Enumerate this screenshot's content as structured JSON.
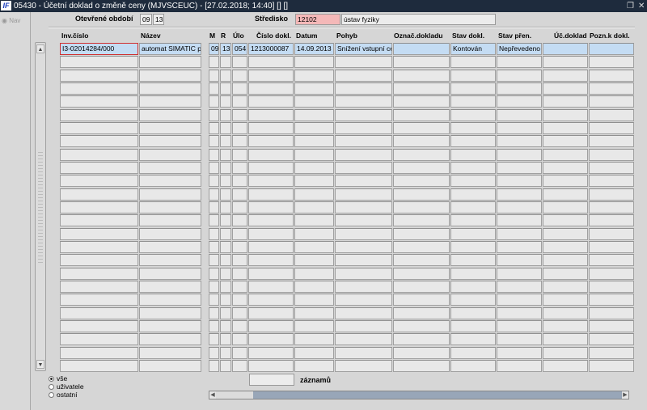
{
  "window": {
    "title": "05430 - Účetní doklad o změně ceny (MJVSCEUC) - [27.02.2018; 14:40]  [] []",
    "logo": "IF",
    "restore_icon": "restore-icon",
    "close_icon": "close-icon"
  },
  "nav": {
    "label": "Nav"
  },
  "header": {
    "period_label": "Otevřené období",
    "period_month": "09",
    "period_year": "13",
    "center_label": "Středisko",
    "center_code": "12102",
    "center_name": "ústav fyziky",
    "center_code_color": "#f4b8b8"
  },
  "table": {
    "columns": [
      "Inv.číslo",
      "Název",
      "M",
      "R",
      "Úlo",
      "Číslo dokl.",
      "Datum",
      "Pohyb",
      "Označ.dokladu",
      "Stav dokl.",
      "Stav přen.",
      "Úč.doklad",
      "Pozn.k dokl."
    ],
    "rows": [
      [
        "I3-02014284/000",
        "automat SIMATIC pr",
        "09",
        "13",
        "054",
        "1213000087",
        "14.09.2013",
        "Snížení vstupní ce",
        "",
        "Kontován",
        "Nepřevedeno",
        "",
        ""
      ]
    ],
    "selected_color": "#c4dcf3"
  },
  "filter": {
    "options": [
      "vše",
      "uživatele",
      "ostatní"
    ],
    "selected": "vše"
  },
  "footer": {
    "count_value": "",
    "count_label": "záznamů"
  }
}
